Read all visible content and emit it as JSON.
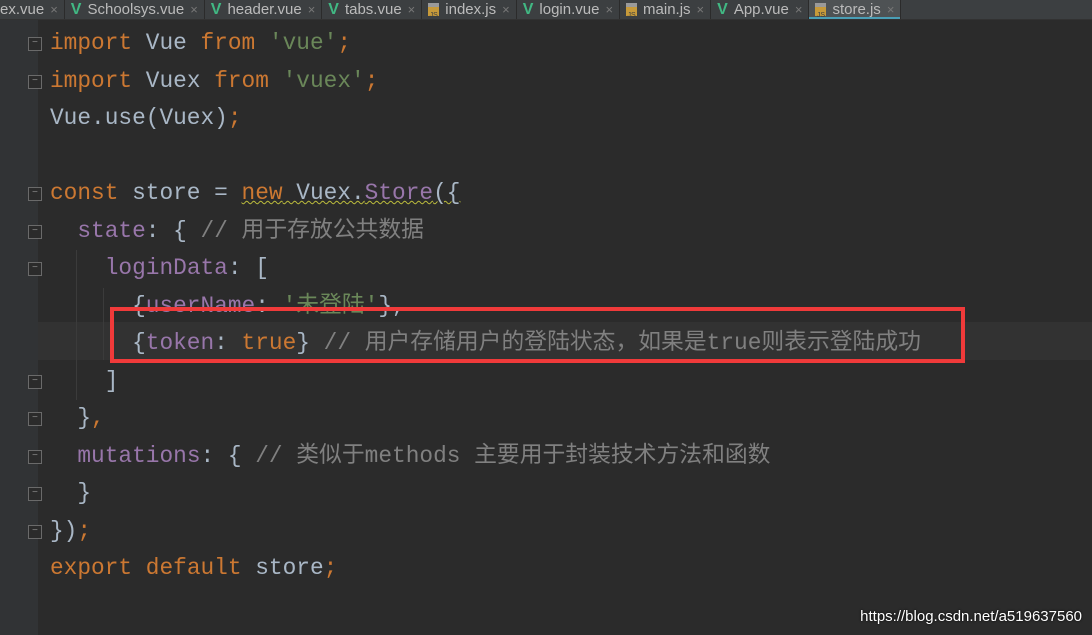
{
  "tabs": [
    {
      "label": "ex.vue",
      "type": "vue"
    },
    {
      "label": "Schoolsys.vue",
      "type": "vue"
    },
    {
      "label": "header.vue",
      "type": "vue"
    },
    {
      "label": "tabs.vue",
      "type": "vue"
    },
    {
      "label": "index.js",
      "type": "js"
    },
    {
      "label": "login.vue",
      "type": "vue"
    },
    {
      "label": "main.js",
      "type": "js"
    },
    {
      "label": "App.vue",
      "type": "vue"
    },
    {
      "label": "store.js",
      "type": "js",
      "active": true
    }
  ],
  "icons": {
    "vue": "vue-file-icon",
    "js": "js-file-icon",
    "close": "close-icon"
  },
  "code": [
    [
      [
        "import",
        "kw"
      ],
      [
        " Vue ",
        "plain"
      ],
      [
        "from",
        "kw"
      ],
      [
        " ",
        "plain"
      ],
      [
        "'vue'",
        "str"
      ],
      [
        ";",
        "kw"
      ]
    ],
    [
      [
        "import",
        "kw"
      ],
      [
        " Vuex ",
        "plain"
      ],
      [
        "from",
        "kw"
      ],
      [
        " ",
        "plain"
      ],
      [
        "'vuex'",
        "str"
      ],
      [
        ";",
        "kw"
      ]
    ],
    [
      [
        "Vue.use(Vuex)",
        "plain"
      ],
      [
        ";",
        "kw"
      ]
    ],
    [],
    [
      [
        "const",
        "kw"
      ],
      [
        " store = ",
        "plain"
      ],
      [
        "new",
        "kw wavy"
      ],
      [
        " Vuex.",
        "plain wavy"
      ],
      [
        "Store",
        "prop wavy"
      ],
      [
        "({",
        "plain wavy"
      ]
    ],
    [
      [
        "  ",
        "plain"
      ],
      [
        "state",
        "prop"
      ],
      [
        ": { ",
        "plain"
      ],
      [
        "// 用于存放公共数据",
        "cm"
      ]
    ],
    [
      [
        "    ",
        "plain"
      ],
      [
        "loginData",
        "prop"
      ],
      [
        ": [",
        "plain"
      ]
    ],
    [
      [
        "      {",
        "plain"
      ],
      [
        "userName",
        "prop"
      ],
      [
        ": ",
        "plain"
      ],
      [
        "'未登陆'",
        "str"
      ],
      [
        "},",
        "plain"
      ]
    ],
    [
      [
        "      {",
        "plain"
      ],
      [
        "token",
        "prop"
      ],
      [
        ": ",
        "plain"
      ],
      [
        "true",
        "kw"
      ],
      [
        "} ",
        "plain"
      ],
      [
        "// 用户存储用户的登陆状态，如果是true则表示登陆成功",
        "cm"
      ]
    ],
    [
      [
        "    ]",
        "plain"
      ]
    ],
    [
      [
        "  }",
        "plain"
      ],
      [
        ",",
        "kw"
      ]
    ],
    [
      [
        "  ",
        "plain"
      ],
      [
        "mutations",
        "prop"
      ],
      [
        ": { ",
        "plain"
      ],
      [
        "// 类似于methods 主要用于封装技术方法和函数",
        "cm"
      ]
    ],
    [
      [
        "  }",
        "plain"
      ]
    ],
    [
      [
        "})",
        "plain"
      ],
      [
        ";",
        "kw"
      ]
    ],
    [
      [
        "export",
        "kw"
      ],
      [
        " ",
        "plain"
      ],
      [
        "default",
        "kw"
      ],
      [
        " store",
        "plain"
      ],
      [
        ";",
        "kw"
      ]
    ]
  ],
  "watermark": "https://blog.csdn.net/a519637560"
}
